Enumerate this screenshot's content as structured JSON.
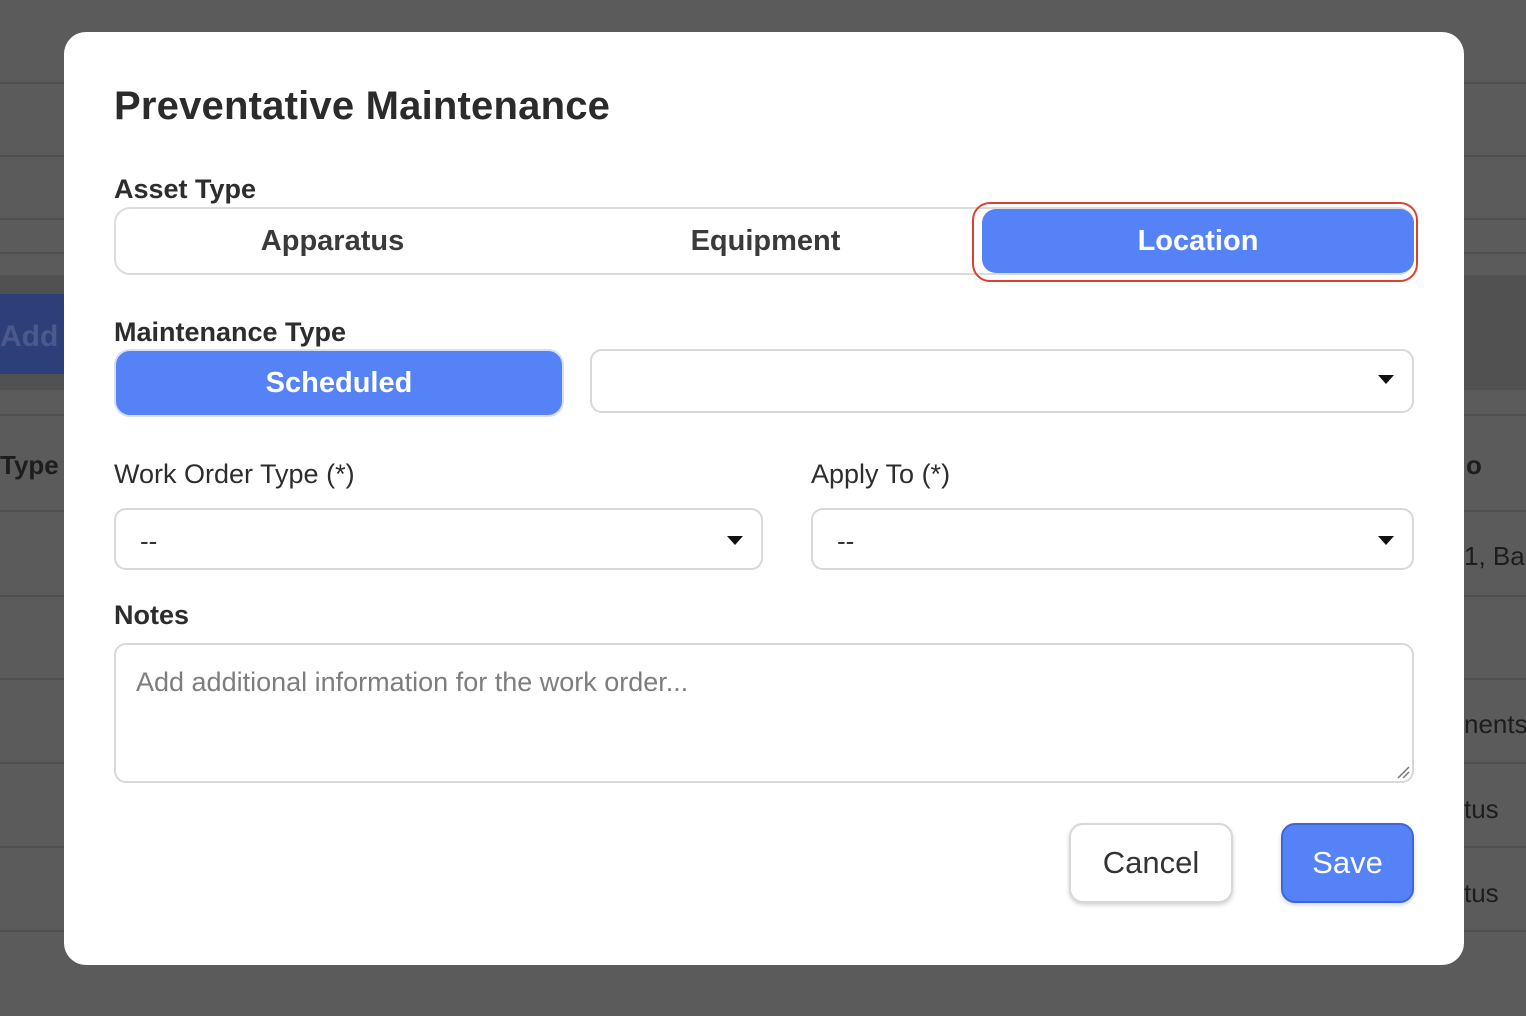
{
  "background": {
    "add_button_text": "Add N",
    "column_left": "Type",
    "column_right": "o",
    "row_fragments": [
      "1, Ba",
      "nents",
      "tus",
      "tus"
    ]
  },
  "modal": {
    "title": "Preventative Maintenance",
    "asset_type": {
      "label": "Asset Type",
      "options": [
        "Apparatus",
        "Equipment",
        "Location"
      ],
      "selected": "Location"
    },
    "maintenance_type": {
      "label": "Maintenance Type",
      "toggle_label": "Scheduled",
      "select_value": ""
    },
    "work_order_type": {
      "label": "Work Order Type (*)",
      "value": "--"
    },
    "apply_to": {
      "label": "Apply To (*)",
      "value": "--"
    },
    "notes": {
      "label": "Notes",
      "placeholder": "Add additional information for the work order..."
    },
    "actions": {
      "cancel_label": "Cancel",
      "save_label": "Save"
    }
  },
  "colors": {
    "accent": "#5682f7",
    "focus_ring": "#d9432e",
    "overlay": "#5b5b5b"
  },
  "icons": {
    "dropdown": "chevron-down-icon",
    "resize": "resize-handle-icon"
  }
}
